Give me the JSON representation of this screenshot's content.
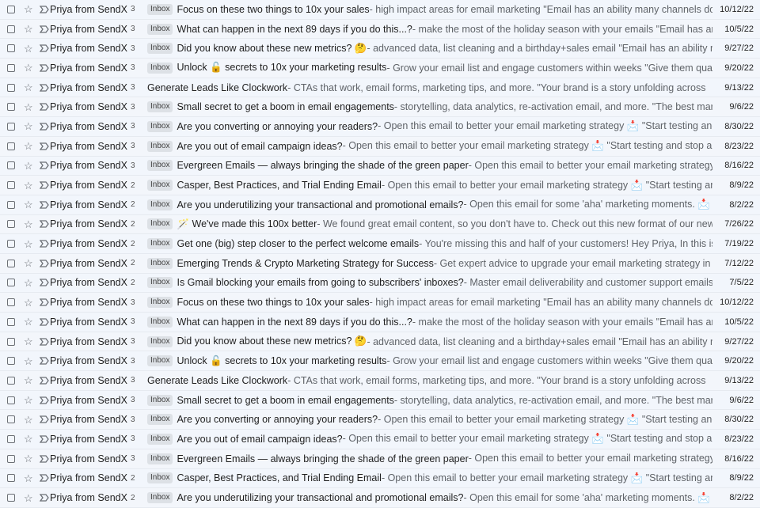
{
  "rows": [
    {
      "sender": "Priya from SendX",
      "count": "3",
      "badge": "Inbox",
      "subject": "Focus on these two things to 10x your sales",
      "snippet": " - high impact areas for email marketing \"Email has an ability many channels don't: creating",
      "date": "10/12/22"
    },
    {
      "sender": "Priya from SendX",
      "count": "3",
      "badge": "Inbox",
      "subject": "What can happen in the next 89 days if you do this...?",
      "snippet": " - make the most of the holiday season with your emails \"Email has an ability many channels don",
      "date": "10/5/22"
    },
    {
      "sender": "Priya from SendX",
      "count": "3",
      "badge": "Inbox",
      "subject": "Did you know about these new metrics? 🤔",
      "snippet": " - advanced data, list cleaning and a birthday+sales email \"Email has an ability many channels don",
      "date": "9/27/22"
    },
    {
      "sender": "Priya from SendX",
      "count": "3",
      "badge": "Inbox",
      "subject": "Unlock 🔓 secrets to 10x your marketing results",
      "snippet": " - Grow your email list and engage customers within weeks \"Give them quality. That's the best",
      "date": "9/20/22"
    },
    {
      "sender": "Priya from SendX",
      "count": "3",
      "badge": "",
      "subject": "Generate Leads Like Clockwork",
      "snippet": " - CTAs that work, email forms, marketing tips, and more. \"Your brand is a story unfolding across",
      "date": "9/13/22"
    },
    {
      "sender": "Priya from SendX",
      "count": "3",
      "badge": "Inbox",
      "subject": "Small secret to get a boom in email engagements",
      "snippet": " - storytelling, data analytics, re-activation email, and more. \"The best marketing doesn't",
      "date": "9/6/22"
    },
    {
      "sender": "Priya from SendX",
      "count": "3",
      "badge": "Inbox",
      "subject": "Are you converting or annoying your readers?",
      "snippet": " - Open this email to better your email marketing strategy 📩 \"Start testing and stop arguing.\"",
      "date": "8/30/22"
    },
    {
      "sender": "Priya from SendX",
      "count": "3",
      "badge": "Inbox",
      "subject": "Are you out of email campaign ideas?",
      "snippet": " - Open this email to better your email marketing strategy 📩 \"Start testing and stop arguing.\"",
      "date": "8/23/22"
    },
    {
      "sender": "Priya from SendX",
      "count": "3",
      "badge": "Inbox",
      "subject": "Evergreen Emails — always bringing the shade of the green paper",
      "snippet": " - Open this email to better your email marketing strategy 📩 \"Start testing and stop arguing.\"",
      "date": "8/16/22"
    },
    {
      "sender": "Priya from SendX",
      "count": "2",
      "badge": "Inbox",
      "subject": "Casper, Best Practices, and Trial Ending Email",
      "snippet": " - Open this email to better your email marketing strategy 📩 \"Start testing and stop arguing.\"",
      "date": "8/9/22"
    },
    {
      "sender": "Priya from SendX",
      "count": "2",
      "badge": "Inbox",
      "subject": "Are you underutilizing your transactional and promotional emails?",
      "snippet": " - Open this email for some 'aha' marketing moments. 📩 \"Start testing and stop arguing.",
      "date": "8/2/22"
    },
    {
      "sender": "Priya from SendX",
      "count": "2",
      "badge": "Inbox",
      "subject": "🪄 We've made this 100x better",
      "snippet": " - We found great email content, so you don't have to. Check out this new format of our newsletter 📩",
      "date": "7/26/22"
    },
    {
      "sender": "Priya from SendX",
      "count": "2",
      "badge": "Inbox",
      "subject": "Get one (big) step closer to the perfect welcome emails",
      "snippet": " - You're missing this and half of your customers! Hey Priya, In this issue of the Sendx newsletter,",
      "date": "7/19/22"
    },
    {
      "sender": "Priya from SendX",
      "count": "2",
      "badge": "Inbox",
      "subject": "Emerging Trends & Crypto Marketing Strategy for Success",
      "snippet": " - Get expert advice to upgrade your email marketing strategy in minutes. Hey Priya, In this issue of",
      "date": "7/12/22"
    },
    {
      "sender": "Priya from SendX",
      "count": "2",
      "badge": "Inbox",
      "subject": "Is Gmail blocking your emails from going to subscribers' inboxes?",
      "snippet": " - Master email deliverability and customer support emails Hey Priya, In this issue of the Sendx",
      "date": "7/5/22"
    },
    {
      "sender": "Priya from SendX",
      "count": "3",
      "badge": "Inbox",
      "subject": "Focus on these two things to 10x your sales",
      "snippet": " - high impact areas for email marketing \"Email has an ability many channels don't: creating",
      "date": "10/12/22"
    },
    {
      "sender": "Priya from SendX",
      "count": "3",
      "badge": "Inbox",
      "subject": "What can happen in the next 89 days if you do this...?",
      "snippet": " - make the most of the holiday season with your emails \"Email has an ability many channels don",
      "date": "10/5/22"
    },
    {
      "sender": "Priya from SendX",
      "count": "3",
      "badge": "Inbox",
      "subject": "Did you know about these new metrics? 🤔",
      "snippet": " - advanced data, list cleaning and a birthday+sales email \"Email has an ability many channels don",
      "date": "9/27/22"
    },
    {
      "sender": "Priya from SendX",
      "count": "3",
      "badge": "Inbox",
      "subject": "Unlock 🔓 secrets to 10x your marketing results",
      "snippet": " - Grow your email list and engage customers within weeks \"Give them quality. That's the best",
      "date": "9/20/22"
    },
    {
      "sender": "Priya from SendX",
      "count": "3",
      "badge": "",
      "subject": "Generate Leads Like Clockwork",
      "snippet": " - CTAs that work, email forms, marketing tips, and more. \"Your brand is a story unfolding across",
      "date": "9/13/22"
    },
    {
      "sender": "Priya from SendX",
      "count": "3",
      "badge": "Inbox",
      "subject": "Small secret to get a boom in email engagements",
      "snippet": " - storytelling, data analytics, re-activation email, and more. \"The best marketing doesn't",
      "date": "9/6/22"
    },
    {
      "sender": "Priya from SendX",
      "count": "3",
      "badge": "Inbox",
      "subject": "Are you converting or annoying your readers?",
      "snippet": " - Open this email to better your email marketing strategy 📩 \"Start testing and stop arguing.\"",
      "date": "8/30/22"
    },
    {
      "sender": "Priya from SendX",
      "count": "3",
      "badge": "Inbox",
      "subject": "Are you out of email campaign ideas?",
      "snippet": " - Open this email to better your email marketing strategy 📩 \"Start testing and stop arguing.\"",
      "date": "8/23/22"
    },
    {
      "sender": "Priya from SendX",
      "count": "3",
      "badge": "Inbox",
      "subject": "Evergreen Emails — always bringing the shade of the green paper",
      "snippet": " - Open this email to better your email marketing strategy 📩 \"Start testing and stop arguing.\"",
      "date": "8/16/22"
    },
    {
      "sender": "Priya from SendX",
      "count": "2",
      "badge": "Inbox",
      "subject": "Casper, Best Practices, and Trial Ending Email",
      "snippet": " - Open this email to better your email marketing strategy 📩 \"Start testing and stop arguing.\"",
      "date": "8/9/22"
    },
    {
      "sender": "Priya from SendX",
      "count": "2",
      "badge": "Inbox",
      "subject": "Are you underutilizing your transactional and promotional emails?",
      "snippet": " - Open this email for some 'aha' marketing moments. 📩 \"Start testing and stop arguing.",
      "date": "8/2/22"
    }
  ]
}
